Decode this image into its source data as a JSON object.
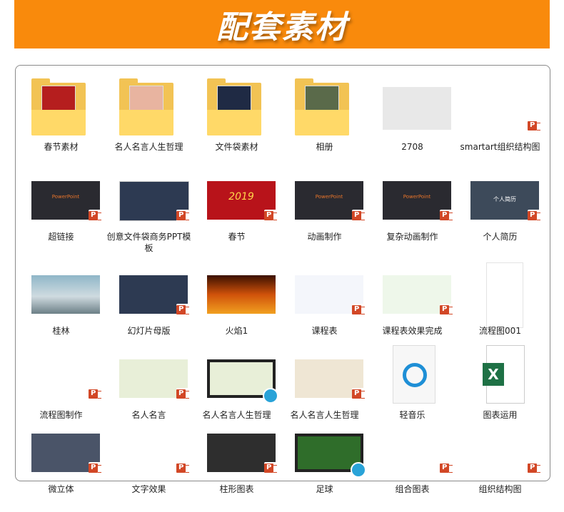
{
  "header": {
    "title": "配套素材"
  },
  "colors": {
    "header_bg": "#f98a0c",
    "panel_border": "#8a8a8a",
    "ppt_badge": "#d24726"
  },
  "rows": [
    {
      "items": [
        {
          "label": "春节素材",
          "type": "folder",
          "icon": "folder-icon"
        },
        {
          "label": "名人名言人生哲理",
          "type": "folder",
          "icon": "folder-icon"
        },
        {
          "label": "文件袋素材",
          "type": "folder",
          "icon": "folder-icon"
        },
        {
          "label": "相册",
          "type": "folder",
          "icon": "folder-icon"
        },
        {
          "label": "2708",
          "type": "image",
          "icon": "laptop-photo-icon"
        },
        {
          "label": "smartart组织结构图",
          "type": "ppt",
          "icon": "ppt-file-icon"
        }
      ]
    },
    {
      "items": [
        {
          "label": "超链接",
          "type": "ppt",
          "icon": "ppt-file-icon",
          "slide_text": "PowerPoint"
        },
        {
          "label": "创意文件袋商务PPT模板",
          "type": "ppt",
          "icon": "ppt-file-icon"
        },
        {
          "label": "春节",
          "type": "ppt",
          "icon": "ppt-file-icon",
          "slide_text": "2019"
        },
        {
          "label": "动画制作",
          "type": "ppt",
          "icon": "ppt-file-icon",
          "slide_text": "PowerPoint"
        },
        {
          "label": "复杂动画制作",
          "type": "ppt",
          "icon": "ppt-file-icon",
          "slide_text": "PowerPoint"
        },
        {
          "label": "个人简历",
          "type": "ppt",
          "icon": "ppt-file-icon",
          "slide_text": "个人简历"
        }
      ]
    },
    {
      "items": [
        {
          "label": "桂林",
          "type": "image",
          "icon": "landscape-photo-icon"
        },
        {
          "label": "幻灯片母版",
          "type": "ppt",
          "icon": "ppt-file-icon"
        },
        {
          "label": "火焰1",
          "type": "image",
          "icon": "fire-photo-icon"
        },
        {
          "label": "课程表",
          "type": "ppt",
          "icon": "ppt-file-icon"
        },
        {
          "label": "课程表效果完成",
          "type": "ppt",
          "icon": "ppt-file-icon"
        },
        {
          "label": "流程图001",
          "type": "image",
          "icon": "flowchart-icon"
        }
      ]
    },
    {
      "items": [
        {
          "label": "流程图制作",
          "type": "ppt",
          "icon": "ppt-file-icon"
        },
        {
          "label": "名人名言",
          "type": "ppt",
          "icon": "ppt-file-icon"
        },
        {
          "label": "名人名言人生哲理",
          "type": "video",
          "icon": "video-file-icon"
        },
        {
          "label": "名人名言人生哲理",
          "type": "ppt",
          "icon": "ppt-file-icon"
        },
        {
          "label": "轻音乐",
          "type": "audio",
          "icon": "music-file-icon"
        },
        {
          "label": "图表运用",
          "type": "excel",
          "icon": "excel-file-icon"
        }
      ]
    },
    {
      "items": [
        {
          "label": "微立体",
          "type": "ppt",
          "icon": "ppt-file-icon"
        },
        {
          "label": "文字效果",
          "type": "ppt",
          "icon": "ppt-file-icon"
        },
        {
          "label": "柱形图表",
          "type": "ppt",
          "icon": "ppt-file-icon"
        },
        {
          "label": "足球",
          "type": "video",
          "icon": "video-file-icon"
        },
        {
          "label": "组合图表",
          "type": "ppt",
          "icon": "ppt-file-icon"
        },
        {
          "label": "组织结构图",
          "type": "ppt",
          "icon": "ppt-file-icon"
        }
      ]
    }
  ]
}
